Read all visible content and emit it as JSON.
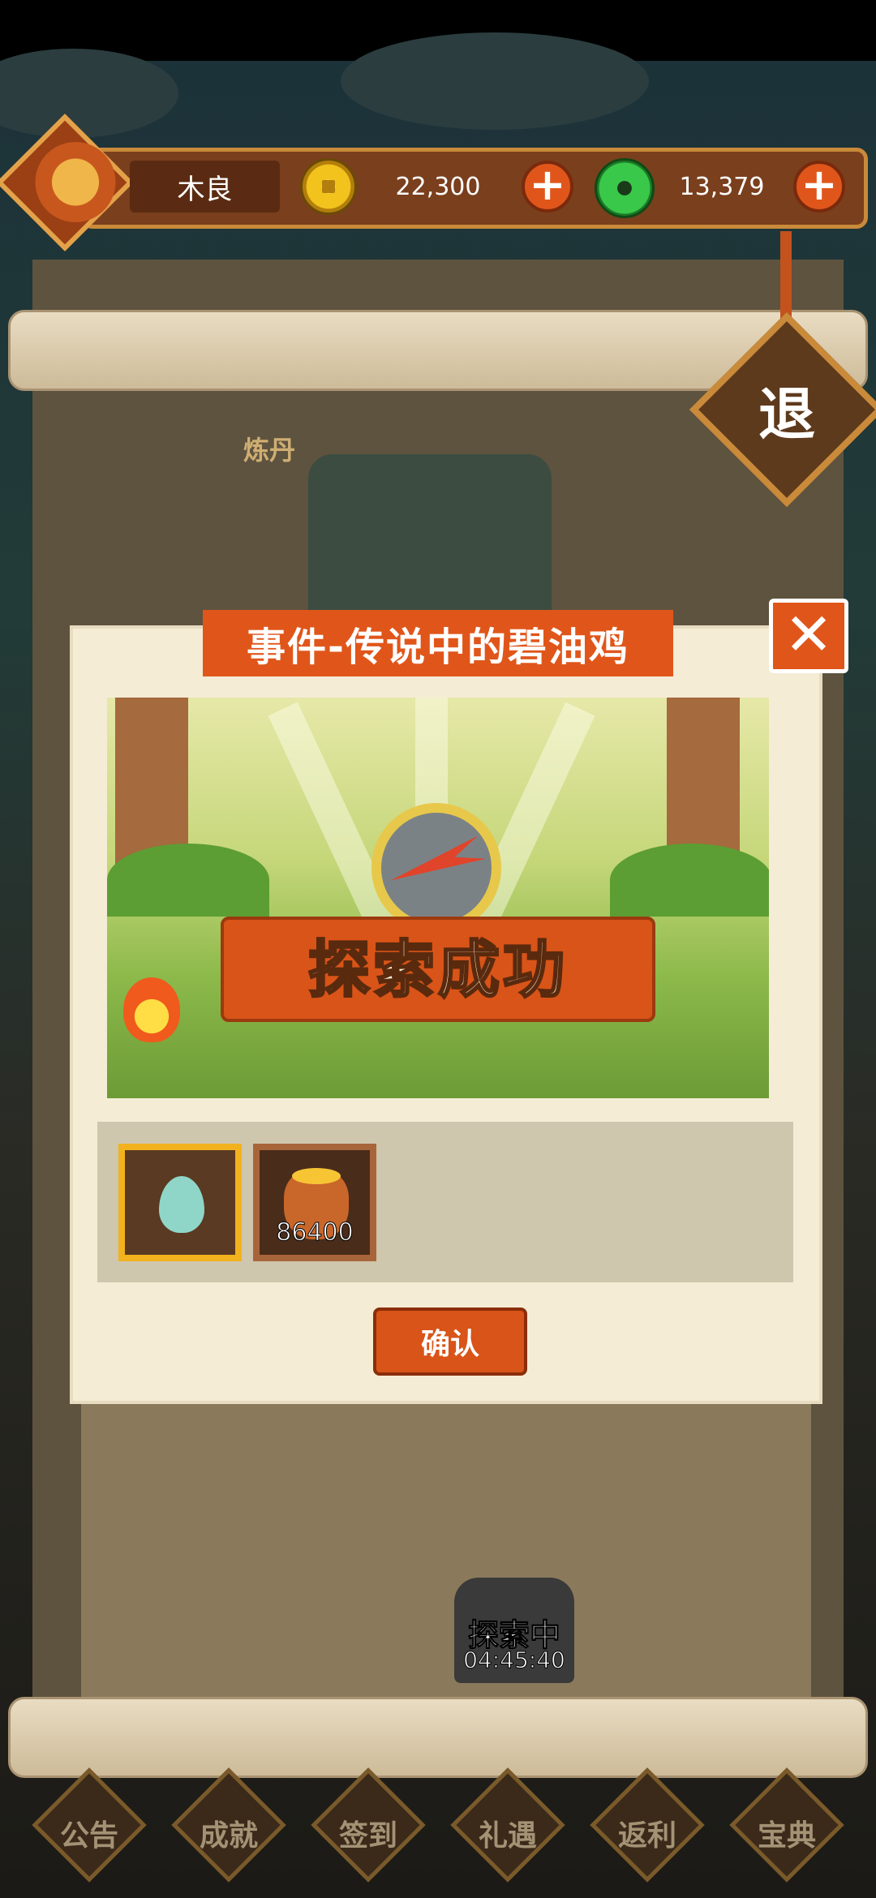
{
  "player": {
    "name": "木良"
  },
  "currencies": {
    "gold": {
      "value": "22,300",
      "icon": "gold-coin-icon"
    },
    "jade": {
      "value": "13,379",
      "icon": "jade-icon"
    }
  },
  "exit": {
    "label": "退"
  },
  "background": {
    "alchemy_label": "炼丹"
  },
  "dialog": {
    "title": "事件-传说中的碧油鸡",
    "banner": "探索成功",
    "rewards": [
      {
        "icon": "egg-icon",
        "count": ""
      },
      {
        "icon": "gold-pouch-icon",
        "count": "86400"
      }
    ],
    "confirm_label": "确认"
  },
  "map": {
    "exploring_label": "探索中",
    "timer": "04:45:40"
  },
  "nav": {
    "items": [
      {
        "label": "公告"
      },
      {
        "label": "成就"
      },
      {
        "label": "签到"
      },
      {
        "label": "礼遇"
      },
      {
        "label": "返利"
      },
      {
        "label": "宝典"
      }
    ]
  },
  "colors": {
    "accent": "#e0561a",
    "panel": "#f5ecd5",
    "gold_frame": "#f2b21d"
  }
}
